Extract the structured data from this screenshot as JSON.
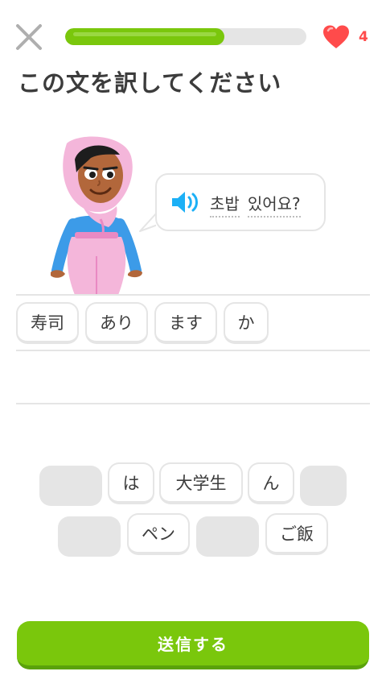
{
  "header": {
    "close_icon": "close-icon",
    "progress": 0.66,
    "hearts_icon": "heart-icon",
    "hearts_count": "4"
  },
  "prompt": {
    "title": "この文を訳してください"
  },
  "speech": {
    "speaker_icon": "speaker-icon",
    "words": [
      "초밥",
      "있어요?"
    ]
  },
  "answer_tiles": [
    "寿司",
    "あり",
    "ます",
    "か"
  ],
  "word_bank": {
    "row1": [
      "は",
      "大学生",
      "ん"
    ],
    "row2": [
      "ペン",
      "ご飯"
    ]
  },
  "actions": {
    "submit_label": "送信する"
  },
  "colors": {
    "accent_green": "#7ac70c",
    "heart_red": "#ff4b4b",
    "speaker_blue": "#1cb0f6",
    "border_gray": "#e5e5e5"
  }
}
